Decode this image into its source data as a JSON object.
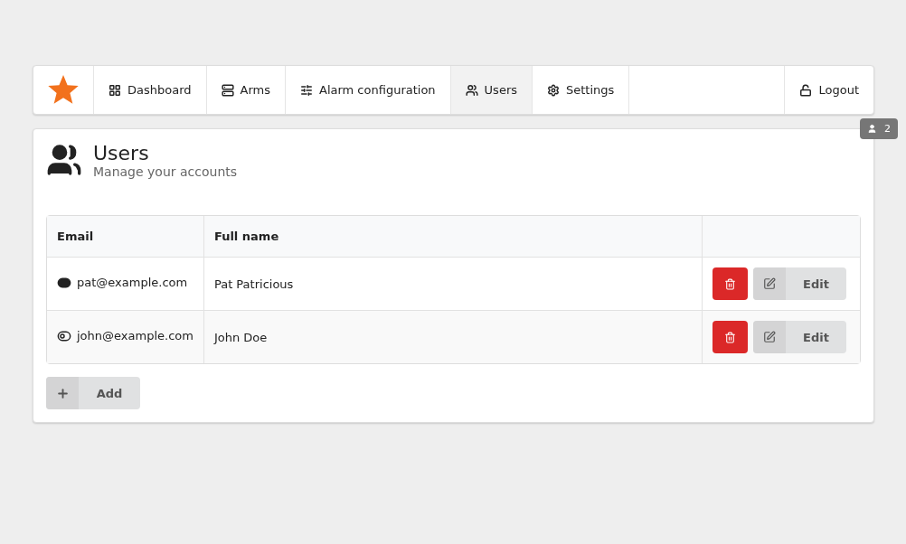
{
  "menu": {
    "items": [
      {
        "kind": "grid",
        "label": "Dashboard",
        "selected": false
      },
      {
        "kind": "server",
        "label": "Arms",
        "selected": false
      },
      {
        "kind": "sliders",
        "label": "Alarm configuration",
        "selected": false
      },
      {
        "kind": "users",
        "label": "Users",
        "selected": true
      },
      {
        "kind": "gear",
        "label": "Settings",
        "selected": false
      }
    ],
    "logout": "Logout"
  },
  "online_badge": "2",
  "page": {
    "title": "Users",
    "subtitle": "Manage your accounts"
  },
  "table": {
    "columns": [
      "Email",
      "Full name"
    ],
    "rows": [
      {
        "email": "pat@example.com",
        "full_name": "Pat Patricious",
        "on": true,
        "edit": "Edit"
      },
      {
        "email": "john@example.com",
        "full_name": "John Doe",
        "on": false,
        "edit": "Edit"
      }
    ]
  },
  "add_button": "Add"
}
